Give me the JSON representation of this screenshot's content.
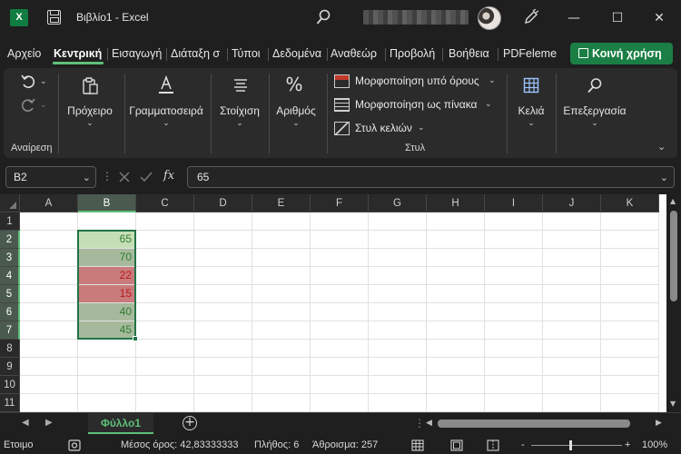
{
  "titlebar": {
    "app_logo": "X",
    "title": "Βιβλίο1 - Excel",
    "minimize": "—",
    "maximize": "☐",
    "close": "✕"
  },
  "tabs": [
    "Αρχείο",
    "Κεντρική",
    "Εισαγωγή",
    "Διάταξη σ",
    "Τύποι",
    "Δεδομένα",
    "Αναθεώρ",
    "Προβολή",
    "Βοήθεια",
    "PDFeleme"
  ],
  "active_tab": "Κεντρική",
  "share_label": "Κοινή χρήση",
  "ribbon": {
    "undo_group": "Αναίρεση",
    "clipboard": "Πρόχειρο",
    "font": "Γραμματοσειρά",
    "alignment": "Στοίχιση",
    "number": "Αριθμός",
    "number_icon": "%",
    "conditional_formatting": "Μορφοποίηση υπό όρους",
    "format_as_table": "Μορφοποίηση ως πίνακα",
    "cell_styles": "Στυλ κελιών",
    "styles_group": "Στυλ",
    "cells": "Κελιά",
    "editing": "Επεξεργασία"
  },
  "formula_bar": {
    "name_box": "B2",
    "fx": "fx",
    "value": "65"
  },
  "grid": {
    "columns": [
      "A",
      "B",
      "C",
      "D",
      "E",
      "F",
      "G",
      "H",
      "I",
      "J",
      "K"
    ],
    "rows": [
      "1",
      "2",
      "3",
      "4",
      "5",
      "6",
      "7",
      "8",
      "9",
      "10",
      "11"
    ],
    "selected_column": "B",
    "values": [
      {
        "row": 2,
        "value": "65",
        "bg": "#c6deb5",
        "fg": "#2e7d32"
      },
      {
        "row": 3,
        "value": "70",
        "bg": "#a7b99c",
        "fg": "#2e7d32"
      },
      {
        "row": 4,
        "value": "22",
        "bg": "#c97a7b",
        "fg": "#b71c1c"
      },
      {
        "row": 5,
        "value": "15",
        "bg": "#c97a7b",
        "fg": "#b71c1c"
      },
      {
        "row": 6,
        "value": "40",
        "bg": "#a7b99c",
        "fg": "#2e7d32"
      },
      {
        "row": 7,
        "value": "45",
        "bg": "#a7b99c",
        "fg": "#2e7d32"
      }
    ]
  },
  "sheet": {
    "name": "Φύλλο1",
    "add": "+"
  },
  "status": {
    "ready": "Ετοιμο",
    "average": "Μέσος όρος: 42,83333333",
    "count": "Πλήθος: 6",
    "sum": "Άθροισμα: 257",
    "zoom": "100%",
    "zoom_minus": "-",
    "zoom_plus": "+"
  },
  "colors": {
    "accent": "#1b7f45",
    "selection": "#217346",
    "tab_green": "#5fbf7a"
  }
}
